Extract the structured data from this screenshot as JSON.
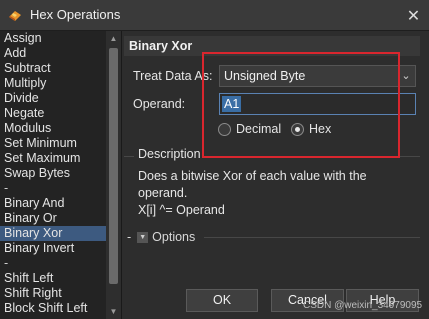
{
  "window": {
    "title": "Hex Operations",
    "close_glyph": "✕",
    "icon": "hex-app-icon"
  },
  "operations": [
    "Assign",
    "Add",
    "Subtract",
    "Multiply",
    "Divide",
    "Negate",
    "Modulus",
    "Set Minimum",
    "Set Maximum",
    "Swap Bytes",
    "-",
    "Binary And",
    "Binary Or",
    "Binary Xor",
    "Binary Invert",
    "-",
    "Shift Left",
    "Shift Right",
    "Block Shift Left"
  ],
  "selected_operation": "Binary Xor",
  "scrollbar": {
    "up_glyph": "▲",
    "down_glyph": "▼"
  },
  "panel": {
    "header": "Binary Xor",
    "treat_label": "Treat Data As:",
    "treat_value": "Unsigned Byte",
    "combo_arrow": "⌄",
    "operand_label": "Operand:",
    "operand_value": "A1",
    "radio_decimal": "Decimal",
    "radio_hex": "Hex",
    "radio_selected": "Hex",
    "description_title": "Description",
    "description_line1": "Does a bitwise Xor of each value with the",
    "description_line2": "operand.",
    "description_line3": "X[i] ^= Operand",
    "options_label": "Options",
    "options_toggle": "▼",
    "options_dash": "-"
  },
  "buttons": {
    "ok": "OK",
    "cancel": "Cancel",
    "help": "Help"
  },
  "watermark": "CSDN @weixin_34979095",
  "colors": {
    "highlight": "#d9262e",
    "selection": "#3d5a80"
  }
}
